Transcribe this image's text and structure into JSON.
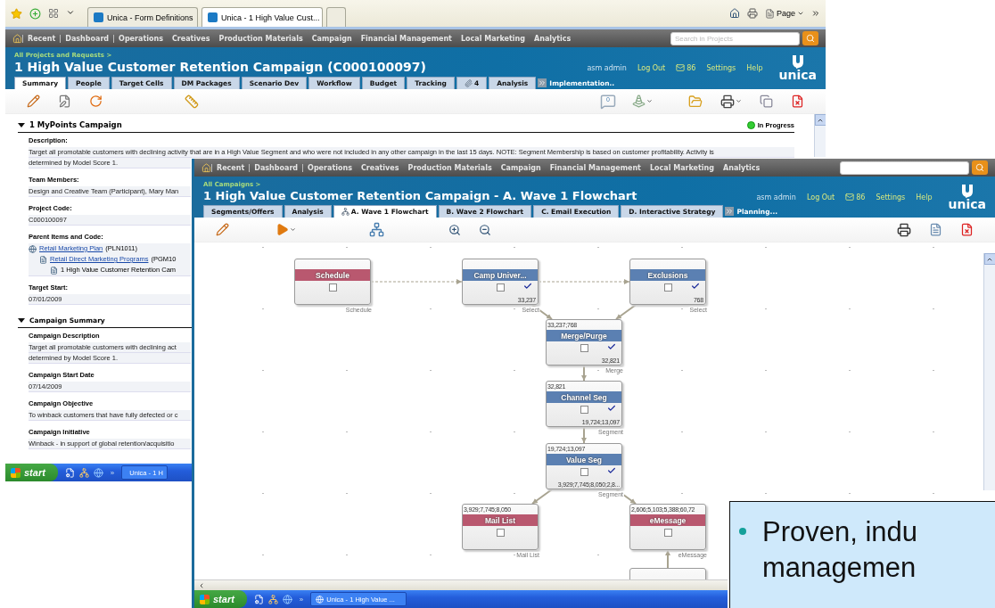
{
  "back_window": {
    "browser": {
      "tabs": [
        {
          "label": "Unica - Form Definitions",
          "selected": false
        },
        {
          "label": "Unica - 1 High Value Cust...",
          "selected": true
        }
      ],
      "page_menu": "Page"
    },
    "nav": [
      {
        "label": "Recent",
        "separated": true
      },
      {
        "label": "Dashboard",
        "separated": true
      },
      {
        "label": "Operations",
        "separated": true
      },
      {
        "label": "Creatives",
        "separated": false
      },
      {
        "label": "Production Materials",
        "separated": false
      },
      {
        "label": "Campaign",
        "separated": false
      },
      {
        "label": "Financial Management",
        "separated": false
      },
      {
        "label": "Local Marketing",
        "separated": false
      },
      {
        "label": "Analytics",
        "separated": false
      }
    ],
    "search": {
      "placeholder": "Search in Projects"
    },
    "breadcrumb": "All Projects and Requests >",
    "title": "1 High Value Customer Retention Campaign (C000100097)",
    "user": {
      "name": "asm admin",
      "logout": "Log Out",
      "messages": "86",
      "settings": "Settings",
      "help": "Help",
      "logo": "unica"
    },
    "tabs": [
      {
        "label": "Summary",
        "selected": true,
        "kind": "text"
      },
      {
        "label": "People",
        "selected": false,
        "kind": "text"
      },
      {
        "label": "Target Cells",
        "selected": false,
        "kind": "text"
      },
      {
        "label": "DM Packages",
        "selected": false,
        "kind": "text"
      },
      {
        "label": "Scenario Dev",
        "selected": false,
        "kind": "text"
      },
      {
        "label": "Workflow",
        "selected": false,
        "kind": "text"
      },
      {
        "label": "Budget",
        "selected": false,
        "kind": "text"
      },
      {
        "label": "Tracking",
        "selected": false,
        "kind": "text"
      },
      {
        "label": "4",
        "selected": false,
        "kind": "attachments"
      },
      {
        "label": "Analysis",
        "selected": false,
        "kind": "text"
      }
    ],
    "more_tab": "Implementation..",
    "comments": "0",
    "section": {
      "title": "1 MyPoints Campaign",
      "status": "In Progress"
    },
    "fields": [
      {
        "label": "Description:",
        "lines": [
          "Target all promotable customers with declining activity that are in a High Value Segment and who were not included in any other campaign in the last 15 days. NOTE: Segment Membership is based on customer profitability. Activity is",
          "determined by Model Score 1."
        ]
      },
      {
        "label": "Team Members:",
        "lines": [
          "Design and Creative Team (Participant), Mary Man"
        ]
      },
      {
        "label": "Project Code:",
        "lines": [
          "C000100097"
        ]
      }
    ],
    "parent_items": {
      "label": "Parent Items and Code:",
      "tree": [
        {
          "kind": "link",
          "text": "Retail Marketing Plan",
          "code": "(PLN1011)",
          "children": [
            {
              "kind": "link",
              "text": "Retail Direct Marketing Programs",
              "code": "(PGM10",
              "children": [
                {
                  "kind": "plain",
                  "text": "1 High Value Customer Retention Cam"
                }
              ]
            }
          ]
        }
      ]
    },
    "fields2": [
      {
        "label": "Target Start:",
        "lines": [
          "07/01/2009"
        ]
      }
    ],
    "summary": {
      "title": "Campaign Summary",
      "fields": [
        {
          "label": "Campaign Description",
          "lines": [
            "Target all promotable customers with declining act",
            "determined by Model Score 1."
          ]
        },
        {
          "label": "Campaign Start Date",
          "lines": [
            "07/14/2009"
          ]
        },
        {
          "label": "Campaign Objective",
          "lines": [
            "To winback customers that have fully defected or c"
          ]
        },
        {
          "label": "Campaign Initiative",
          "lines": [
            "Winback - in support of global retention/acquisitio"
          ]
        }
      ]
    },
    "taskbar": {
      "start": "start",
      "overflow": "»",
      "task": "Unica - 1 H"
    }
  },
  "front_window": {
    "nav": [
      {
        "label": "Recent",
        "separated": true
      },
      {
        "label": "Dashboard",
        "separated": true
      },
      {
        "label": "Operations",
        "separated": true
      },
      {
        "label": "Creatives",
        "separated": false
      },
      {
        "label": "Production Materials",
        "separated": false
      },
      {
        "label": "Campaign",
        "separated": false
      },
      {
        "label": "Financial Management",
        "separated": false
      },
      {
        "label": "Local Marketing",
        "separated": false
      },
      {
        "label": "Analytics",
        "separated": false
      }
    ],
    "breadcrumb": "All Campaigns >",
    "title": "1 High Value Customer Retention Campaign - A. Wave 1 Flowchart",
    "user": {
      "name": "asm admin",
      "logout": "Log Out",
      "messages": "86",
      "settings": "Settings",
      "help": "Help",
      "logo": "unica"
    },
    "tabs": [
      {
        "label": "Segments/Offers",
        "selected": false,
        "kind": "text"
      },
      {
        "label": "Analysis",
        "selected": false,
        "kind": "text"
      },
      {
        "label": "A. Wave 1 Flowchart",
        "selected": true,
        "kind": "flowchart"
      },
      {
        "label": "B. Wave 2 Flowchart",
        "selected": false,
        "kind": "text"
      },
      {
        "label": "C. Email Execution",
        "selected": false,
        "kind": "text"
      },
      {
        "label": "D. Interactive Strategy",
        "selected": false,
        "kind": "text"
      }
    ],
    "more_tab": "Planning...",
    "flowchart": {
      "nodes": [
        {
          "kind": "node",
          "title": "Schedule",
          "color": "#b9586f",
          "ran": false,
          "checked": false,
          "process": "Schedule"
        },
        {
          "kind": "node",
          "title": "Camp Univer...",
          "color": "#5b80b2",
          "ran": true,
          "checked": false,
          "count_out": "33,237",
          "process": "Select"
        },
        {
          "kind": "node",
          "title": "Exclusions",
          "color": "#5b80b2",
          "ran": true,
          "checked": false,
          "count_out": "768",
          "process": "Select"
        },
        {
          "kind": "node",
          "title": "Merge/Purge",
          "color": "#5b80b2",
          "ran": true,
          "checked": false,
          "count_in": "33,237;768",
          "count_out": "32,821",
          "process": "Merge"
        },
        {
          "kind": "node",
          "title": "Channel Seg",
          "color": "#5b80b2",
          "ran": true,
          "checked": false,
          "count_in": "32,821",
          "count_out": "19,724;13,097",
          "process": "Segment"
        },
        {
          "kind": "node",
          "title": "Value Seg",
          "color": "#5b80b2",
          "ran": true,
          "checked": false,
          "count_in": "19,724;13,097",
          "count_out": "3,929;7,745;8,050;2,8...",
          "process": "Segment"
        },
        {
          "kind": "node",
          "title": "Mail List",
          "color": "#b9586f",
          "ran": false,
          "checked": false,
          "count_in": "3,929;7,745;8,050",
          "process": "Mail List"
        },
        {
          "kind": "node",
          "title": "eMessage",
          "color": "#b9586f",
          "ran": false,
          "checked": false,
          "count_in": "2,606;5,103;5,388;60,72",
          "process": "eMessage"
        },
        {
          "kind": "cut"
        }
      ]
    },
    "taskbar": {
      "start": "start",
      "overflow": "»",
      "task": "Unica - 1 High Value ..."
    }
  },
  "callout": {
    "lines": [
      "Proven, indu",
      "managemen"
    ]
  }
}
